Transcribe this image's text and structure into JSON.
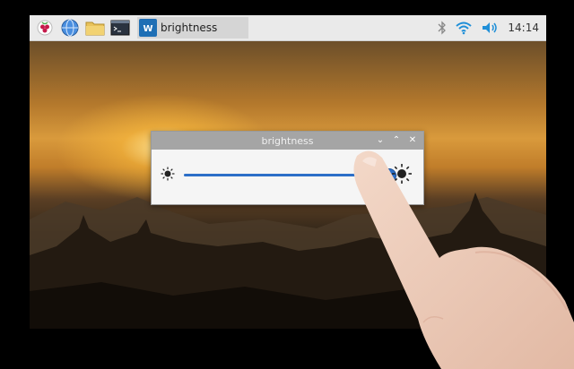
{
  "taskbar": {
    "app_title": "brightness",
    "clock": "14:14",
    "icons": [
      "raspberry-pi-menu-icon",
      "web-browser-icon",
      "file-manager-icon",
      "terminal-icon",
      "bluetooth-icon",
      "wifi-icon",
      "volume-icon"
    ]
  },
  "dialog": {
    "title": "brightness",
    "brightness_level": 0.96
  },
  "colors": {
    "accent": "#2c6fc8",
    "taskbar": "#eaeaea",
    "titlebar": "#a5a5a5"
  }
}
